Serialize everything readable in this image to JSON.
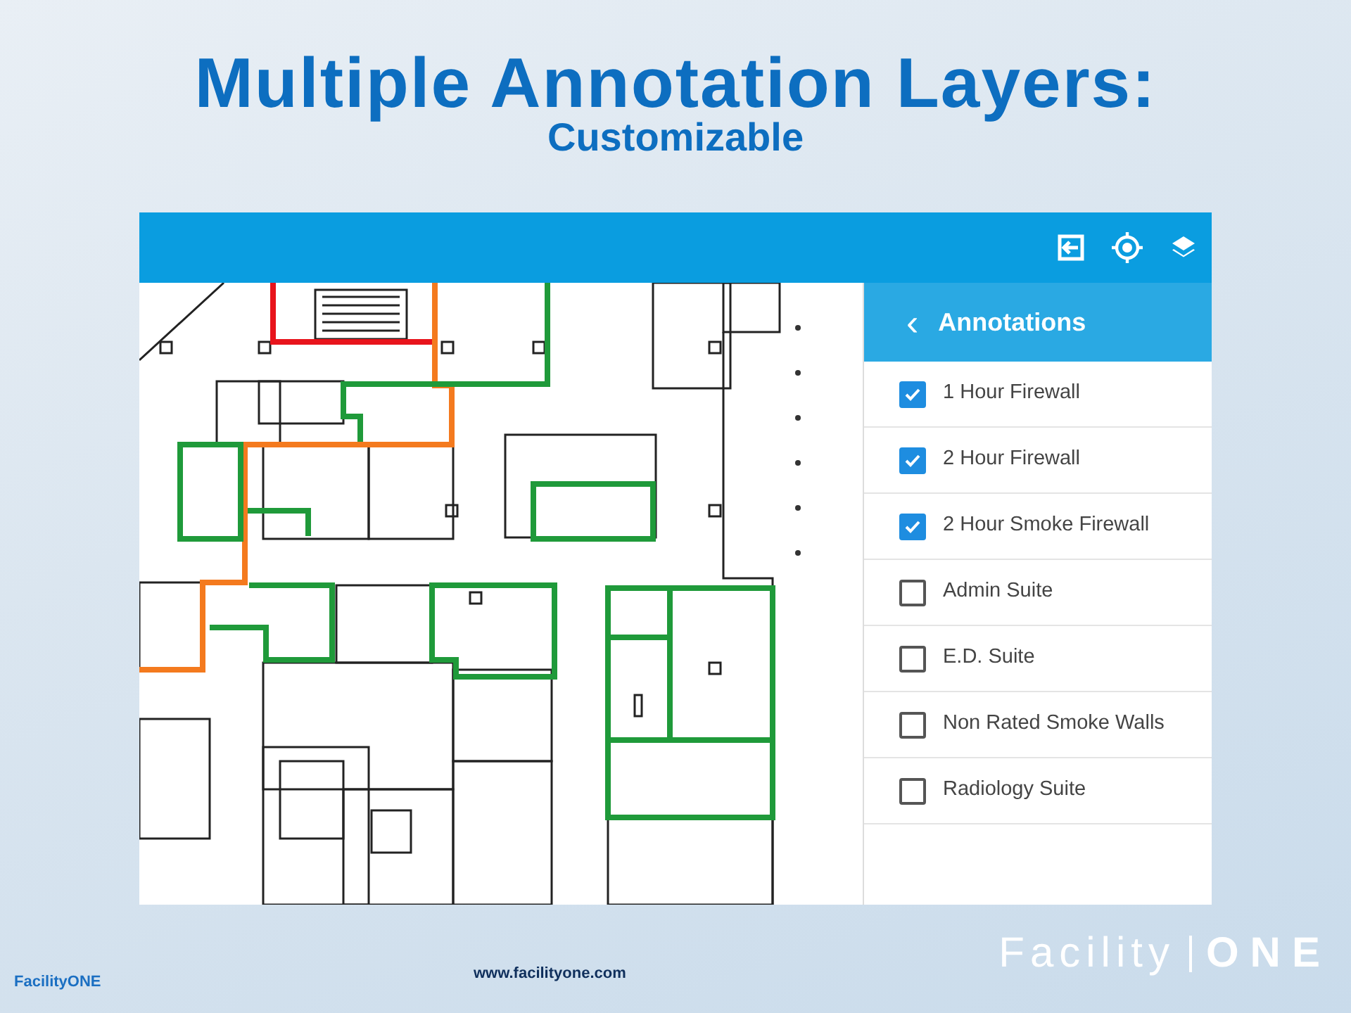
{
  "slide": {
    "title": "Multiple Annotation Layers:",
    "subtitle": "Customizable"
  },
  "app": {
    "panel": {
      "back": "‹",
      "title": "Annotations",
      "layers": [
        {
          "label": "1 Hour Firewall",
          "checked": true
        },
        {
          "label": "2 Hour Firewall",
          "checked": true
        },
        {
          "label": "2 Hour Smoke Firewall",
          "checked": true
        },
        {
          "label": "Admin Suite",
          "checked": false
        },
        {
          "label": "E.D. Suite",
          "checked": false
        },
        {
          "label": "Non Rated Smoke Walls",
          "checked": false
        },
        {
          "label": "Radiology Suite",
          "checked": false
        }
      ]
    }
  },
  "footer": {
    "brand_small": "FacilityONE",
    "website": "www.facilityone.com",
    "logo_left": "Facility",
    "logo_right": "ONE"
  }
}
